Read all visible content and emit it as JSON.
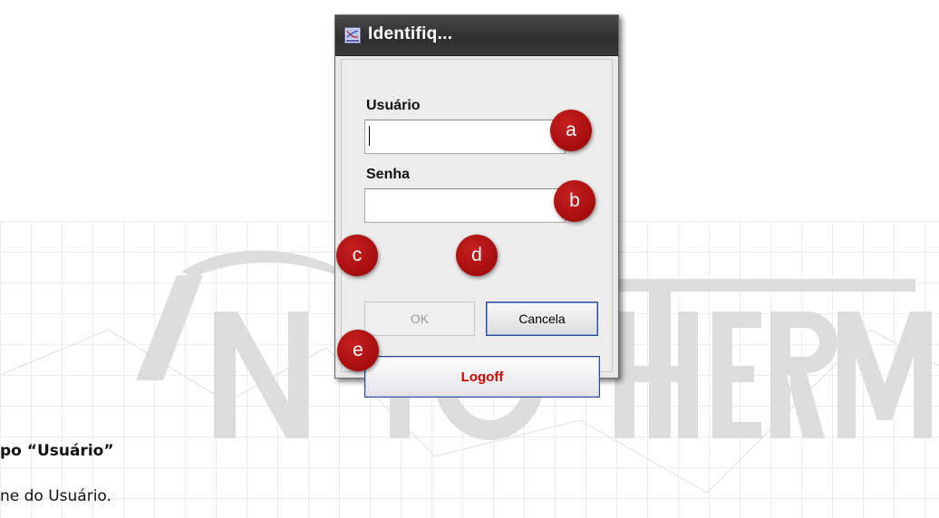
{
  "dialog": {
    "title": "Identifiq...",
    "user_label": "Usuário",
    "user_value": "",
    "password_label": "Senha",
    "password_value": "",
    "ok_label": "OK",
    "cancel_label": "Cancela",
    "logoff_label": "Logoff"
  },
  "markers": [
    "a",
    "b",
    "c",
    "d",
    "e"
  ],
  "document": {
    "line1": "po “Usuário”",
    "line2": "ne do Usuário."
  },
  "watermark": {
    "text": "INFOTHERM"
  },
  "colors": {
    "marker": "#b01212",
    "logoff_text": "#d00000",
    "titlebar": "#2e2e2e"
  },
  "icons": {
    "title": "app-window-icon"
  }
}
